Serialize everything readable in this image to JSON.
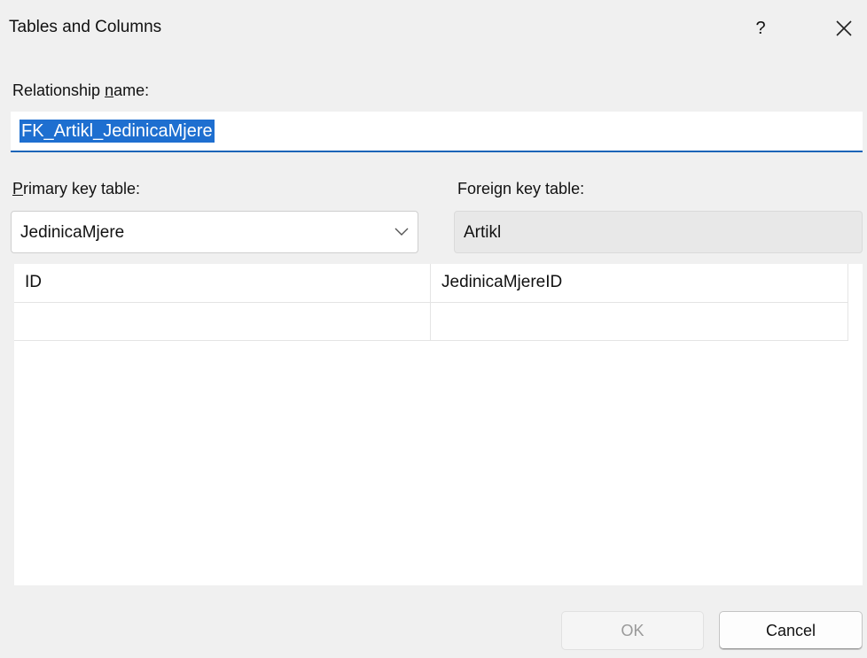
{
  "window": {
    "title": "Tables and Columns",
    "help_label": "?"
  },
  "relationship": {
    "label_pre": "Relationship ",
    "label_accel": "n",
    "label_post": "ame:",
    "value": "FK_Artikl_JedinicaMjere"
  },
  "primary_key": {
    "label_accel": "P",
    "label_post": "rimary key table:",
    "selected": "JedinicaMjere"
  },
  "foreign_key": {
    "label": "Foreign key table:",
    "value": "Artikl"
  },
  "columns": {
    "rows": [
      [
        "ID",
        "JedinicaMjereID"
      ],
      [
        "",
        ""
      ]
    ]
  },
  "buttons": {
    "ok": "OK",
    "cancel": "Cancel"
  },
  "colors": {
    "selection": "#1e6fd0",
    "focus_underline": "#1c65b8",
    "dialog_bg": "#f0f0f0"
  }
}
